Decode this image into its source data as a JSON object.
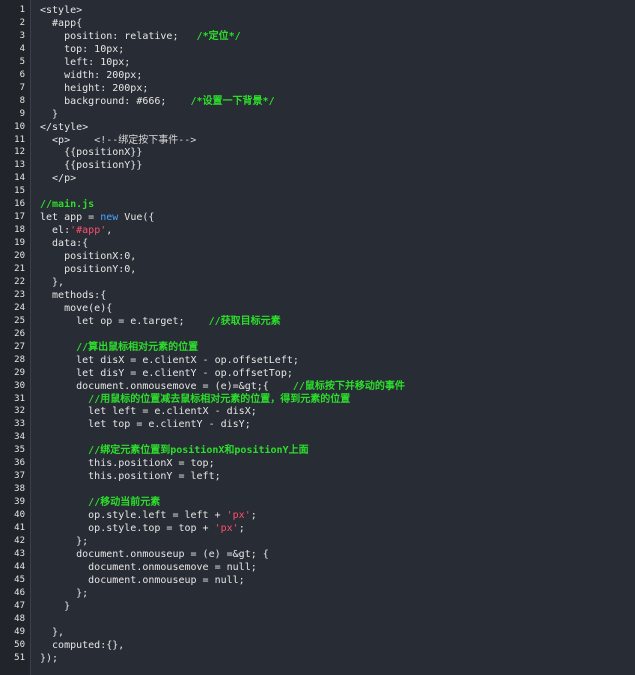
{
  "editor": {
    "lines": [
      {
        "n": "1",
        "segs": [
          {
            "t": "text",
            "v": "<style>"
          }
        ]
      },
      {
        "n": "2",
        "segs": [
          {
            "t": "text",
            "v": "  #app{"
          }
        ]
      },
      {
        "n": "3",
        "segs": [
          {
            "t": "text",
            "v": "    position: relative;   "
          },
          {
            "t": "comment",
            "v": "/*定位*/"
          }
        ]
      },
      {
        "n": "4",
        "segs": [
          {
            "t": "text",
            "v": "    top: 10px;"
          }
        ]
      },
      {
        "n": "5",
        "segs": [
          {
            "t": "text",
            "v": "    left: 10px;"
          }
        ]
      },
      {
        "n": "6",
        "segs": [
          {
            "t": "text",
            "v": "    width: 200px;"
          }
        ]
      },
      {
        "n": "7",
        "segs": [
          {
            "t": "text",
            "v": "    height: 200px;"
          }
        ]
      },
      {
        "n": "8",
        "segs": [
          {
            "t": "text",
            "v": "    background: #666;    "
          },
          {
            "t": "comment",
            "v": "/*设置一下背景*/"
          }
        ]
      },
      {
        "n": "9",
        "segs": [
          {
            "t": "text",
            "v": "  }"
          }
        ]
      },
      {
        "n": "10",
        "segs": [
          {
            "t": "text",
            "v": "</style>"
          }
        ]
      },
      {
        "n": "11",
        "segs": [
          {
            "t": "text",
            "v": "  <p>    "
          },
          {
            "t": "html-comment",
            "v": "<!--绑定按下事件-->"
          }
        ]
      },
      {
        "n": "12",
        "segs": [
          {
            "t": "text",
            "v": "    {{positionX}}"
          }
        ]
      },
      {
        "n": "13",
        "segs": [
          {
            "t": "text",
            "v": "    {{positionY}}"
          }
        ]
      },
      {
        "n": "14",
        "segs": [
          {
            "t": "text",
            "v": "  </p>"
          }
        ]
      },
      {
        "n": "15",
        "segs": []
      },
      {
        "n": "16",
        "segs": [
          {
            "t": "comment",
            "v": "//main.js"
          }
        ]
      },
      {
        "n": "17",
        "segs": [
          {
            "t": "text",
            "v": "let app = "
          },
          {
            "t": "keyword",
            "v": "new"
          },
          {
            "t": "text",
            "v": " Vue({"
          }
        ]
      },
      {
        "n": "18",
        "segs": [
          {
            "t": "text",
            "v": "  el:"
          },
          {
            "t": "string",
            "v": "'#app'"
          },
          {
            "t": "text",
            "v": ","
          }
        ]
      },
      {
        "n": "19",
        "segs": [
          {
            "t": "text",
            "v": "  data:{"
          }
        ]
      },
      {
        "n": "20",
        "segs": [
          {
            "t": "text",
            "v": "    positionX:0,"
          }
        ]
      },
      {
        "n": "21",
        "segs": [
          {
            "t": "text",
            "v": "    positionY:0,"
          }
        ]
      },
      {
        "n": "22",
        "segs": [
          {
            "t": "text",
            "v": "  },"
          }
        ]
      },
      {
        "n": "23",
        "segs": [
          {
            "t": "text",
            "v": "  methods:{"
          }
        ]
      },
      {
        "n": "24",
        "segs": [
          {
            "t": "text",
            "v": "    move(e){"
          }
        ]
      },
      {
        "n": "25",
        "segs": [
          {
            "t": "text",
            "v": "      let op = e.target;    "
          },
          {
            "t": "comment",
            "v": "//获取目标元素"
          }
        ]
      },
      {
        "n": "26",
        "segs": []
      },
      {
        "n": "27",
        "segs": [
          {
            "t": "text",
            "v": "      "
          },
          {
            "t": "comment",
            "v": "//算出鼠标相对元素的位置"
          }
        ]
      },
      {
        "n": "28",
        "segs": [
          {
            "t": "text",
            "v": "      let disX = e.clientX - op.offsetLeft;"
          }
        ]
      },
      {
        "n": "29",
        "segs": [
          {
            "t": "text",
            "v": "      let disY = e.clientY - op.offsetTop;"
          }
        ]
      },
      {
        "n": "30",
        "segs": [
          {
            "t": "text",
            "v": "      document.onmousemove = (e)=&gt;{    "
          },
          {
            "t": "comment",
            "v": "//鼠标按下并移动的事件"
          }
        ]
      },
      {
        "n": "31",
        "segs": [
          {
            "t": "text",
            "v": "        "
          },
          {
            "t": "comment",
            "v": "//用鼠标的位置减去鼠标相对元素的位置，得到元素的位置"
          }
        ]
      },
      {
        "n": "32",
        "segs": [
          {
            "t": "text",
            "v": "        let left = e.clientX - disX;"
          }
        ]
      },
      {
        "n": "33",
        "segs": [
          {
            "t": "text",
            "v": "        let top = e.clientY - disY;"
          }
        ]
      },
      {
        "n": "34",
        "segs": []
      },
      {
        "n": "35",
        "segs": [
          {
            "t": "text",
            "v": "        "
          },
          {
            "t": "comment",
            "v": "//绑定元素位置到positionX和positionY上面"
          }
        ]
      },
      {
        "n": "36",
        "segs": [
          {
            "t": "text",
            "v": "        this.positionX = top;"
          }
        ]
      },
      {
        "n": "37",
        "segs": [
          {
            "t": "text",
            "v": "        this.positionY = left;"
          }
        ]
      },
      {
        "n": "38",
        "segs": []
      },
      {
        "n": "39",
        "segs": [
          {
            "t": "text",
            "v": "        "
          },
          {
            "t": "comment",
            "v": "//移动当前元素"
          }
        ]
      },
      {
        "n": "40",
        "segs": [
          {
            "t": "text",
            "v": "        op.style.left = left + "
          },
          {
            "t": "string",
            "v": "'px'"
          },
          {
            "t": "text",
            "v": ";"
          }
        ]
      },
      {
        "n": "41",
        "segs": [
          {
            "t": "text",
            "v": "        op.style.top = top + "
          },
          {
            "t": "string",
            "v": "'px'"
          },
          {
            "t": "text",
            "v": ";"
          }
        ]
      },
      {
        "n": "42",
        "segs": [
          {
            "t": "text",
            "v": "      };"
          }
        ]
      },
      {
        "n": "43",
        "segs": [
          {
            "t": "text",
            "v": "      document.onmouseup = (e) =&gt; {"
          }
        ]
      },
      {
        "n": "44",
        "segs": [
          {
            "t": "text",
            "v": "        document.onmousemove = null;"
          }
        ]
      },
      {
        "n": "45",
        "segs": [
          {
            "t": "text",
            "v": "        document.onmouseup = null;"
          }
        ]
      },
      {
        "n": "46",
        "segs": [
          {
            "t": "text",
            "v": "      };"
          }
        ]
      },
      {
        "n": "47",
        "segs": [
          {
            "t": "text",
            "v": "    }"
          }
        ]
      },
      {
        "n": "48",
        "segs": []
      },
      {
        "n": "49",
        "segs": [
          {
            "t": "text",
            "v": "  },"
          }
        ]
      },
      {
        "n": "50",
        "segs": [
          {
            "t": "text",
            "v": "  computed:{},"
          }
        ]
      },
      {
        "n": "51",
        "segs": [
          {
            "t": "text",
            "v": "});"
          }
        ]
      }
    ]
  }
}
